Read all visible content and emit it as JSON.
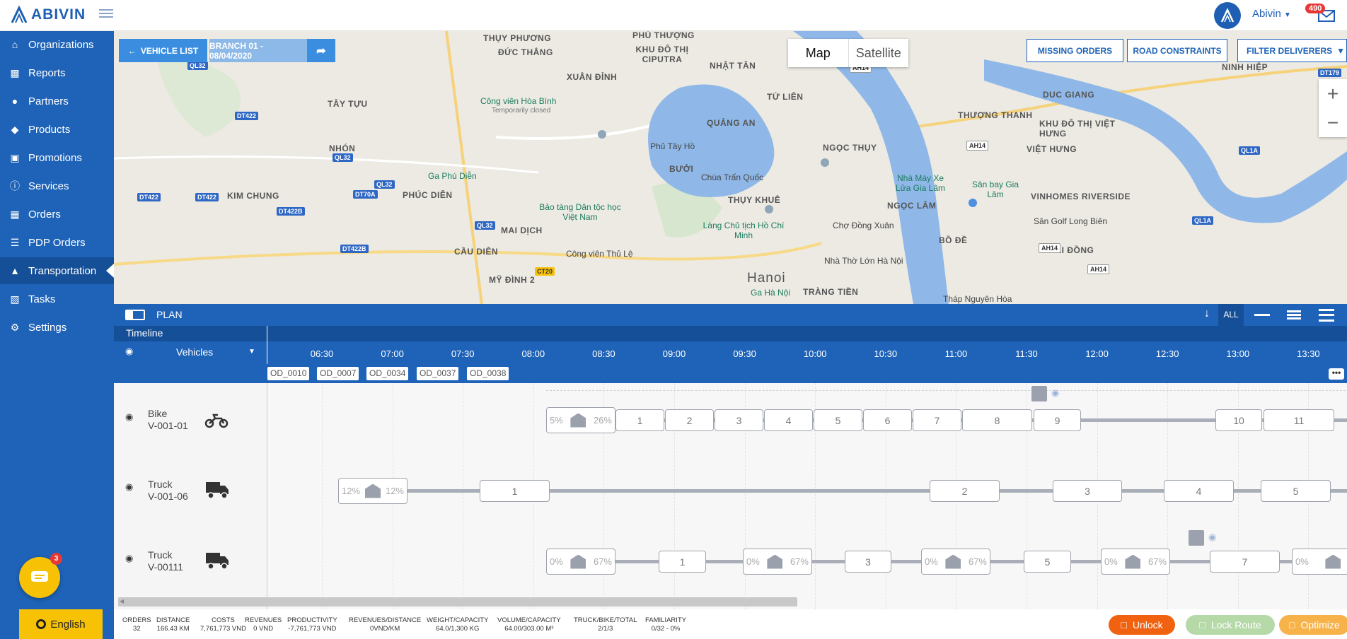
{
  "header": {
    "brand": "ABIVIN",
    "user_name": "Abivin",
    "notification_count": "490"
  },
  "sidebar": {
    "items": [
      {
        "label": "Organizations",
        "icon": "home-icon"
      },
      {
        "label": "Reports",
        "icon": "bar-chart-icon"
      },
      {
        "label": "Partners",
        "icon": "users-icon"
      },
      {
        "label": "Products",
        "icon": "dropbox-icon"
      },
      {
        "label": "Promotions",
        "icon": "gift-icon"
      },
      {
        "label": "Services",
        "icon": "info-icon"
      },
      {
        "label": "Orders",
        "icon": "cubes-icon"
      },
      {
        "label": "PDP Orders",
        "icon": "list-icon"
      },
      {
        "label": "Transportation",
        "icon": "road-icon"
      },
      {
        "label": "Tasks",
        "icon": "calendar-icon"
      },
      {
        "label": "Settings",
        "icon": "gear-icon"
      }
    ],
    "active": "Transportation",
    "chat_badge": "3",
    "language": "English"
  },
  "map": {
    "vehicle_list_label": "VEHICLE LIST",
    "branch_label": "BRANCH 01 - 08/04/2020",
    "map_label": "Map",
    "satellite_label": "Satellite",
    "missing_orders_label": "MISSING ORDERS",
    "road_constraints_label": "ROAD CONSTRAINTS",
    "filter_label": "FILTER DELIVERERS",
    "labels": [
      "THỤY PHƯƠNG",
      "ĐỨC THẮNG",
      "PHÚ THƯỢNG",
      "KHU ĐÔ THỊ CIPUTRA",
      "NHẬT TÂN",
      "XUÂN ĐỈNH",
      "TÂY TỰU",
      "Công viên Hòa Bình",
      "Temporarily closed",
      "QUẢNG AN",
      "TỨ LIÊN",
      "NHÓN",
      "Phủ Tây Hồ",
      "BƯỞI",
      "Chùa Trấn Quốc",
      "THỤY KHUÊ",
      "KIM CHUNG",
      "Ga Phú Diễn",
      "PHÚC DIỄN",
      "Bảo tàng Dân tộc học Việt Nam",
      "Làng Chủ tịch Hồ Chí Minh",
      "MAI DỊCH",
      "CẦU DIỄN",
      "MỸ ĐÌNH 2",
      "Công viên Thủ Lệ",
      "Hanoi",
      "Ga Hà Nội",
      "NGỌC THỤY",
      "Nhà Máy Xe Lửa Gia Lâm",
      "Chợ Đồng Xuân",
      "NGỌC LÂM",
      "Nhà Thờ Lớn Hà Nội",
      "BỒ ĐỀ",
      "TRÀNG TIỀN",
      "Tháp Nguyên Hòa",
      "THƯỢNG THANH",
      "Sân bay Gia Lâm",
      "DUC GIANG",
      "KHU ĐÔ THỊ VIỆT HƯNG",
      "VIỆT HƯNG",
      "VINHOMES RIVERSIDE",
      "Sân Golf Long Biên",
      "SÀI ĐỒNG",
      "NINH HIỆP"
    ],
    "road_tags": [
      "QL32",
      "DT422",
      "QL32",
      "DT422",
      "DT422",
      "DT70A",
      "QL32",
      "DT422B",
      "DT422B",
      "QL32",
      "CT20",
      "AH14",
      "AH14",
      "AH14",
      "AH14",
      "QL1A",
      "QL1A",
      "DT179"
    ]
  },
  "plan": {
    "title": "PLAN",
    "all_label": "ALL",
    "timeline_label": "Timeline",
    "vehicles_label": "Vehicles",
    "times": [
      "06:30",
      "07:00",
      "07:30",
      "08:00",
      "08:30",
      "09:00",
      "09:30",
      "10:00",
      "10:30",
      "11:00",
      "11:30",
      "12:00",
      "12:30",
      "13:00",
      "13:30"
    ],
    "orders": [
      "OD_0010",
      "OD_0007",
      "OD_0034",
      "OD_0037",
      "OD_0038"
    ],
    "vehicles": [
      {
        "type": "Bike",
        "id": "V-001-01",
        "icon": "motorcycle-icon"
      },
      {
        "type": "Truck",
        "id": "V-001-06",
        "icon": "truck-icon"
      },
      {
        "type": "Truck",
        "id": "V-00111",
        "icon": "truck-icon"
      }
    ],
    "routes": [
      {
        "depots": [
          {
            "left": "5%",
            "right": "26%"
          }
        ],
        "stops": [
          "1",
          "2",
          "3",
          "4",
          "5",
          "6",
          "7",
          "8",
          "9",
          "10",
          "11"
        ]
      },
      {
        "depots": [
          {
            "left": "12%",
            "right": "12%"
          }
        ],
        "stops": [
          "1",
          "2",
          "3",
          "4",
          "5"
        ]
      },
      {
        "depots": [
          {
            "left": "0%",
            "right": "67%"
          },
          {
            "left": "0%",
            "right": "67%"
          },
          {
            "left": "0%",
            "right": "67%"
          },
          {
            "left": "0%",
            "right": "67%"
          },
          {
            "left": "0%",
            "right": ""
          }
        ],
        "stops": [
          "1",
          "3",
          "5",
          "7"
        ]
      }
    ]
  },
  "stats": [
    {
      "label": "ORDERS",
      "value": "32"
    },
    {
      "label": "DISTANCE",
      "value": "166.43 KM"
    },
    {
      "label": "COSTS",
      "value": "7,761,773 VND"
    },
    {
      "label": "REVENUES",
      "value": "0 VND"
    },
    {
      "label": "PRODUCTIVITY",
      "value": "-7,761,773 VND"
    },
    {
      "label": "REVENUES/DISTANCE",
      "value": "0VND/KM"
    },
    {
      "label": "WEIGHT/CAPACITY",
      "value": "64.0/1,300 KG"
    },
    {
      "label": "VOLUME/CAPACITY",
      "value": "64.00/303.00 M³"
    },
    {
      "label": "TRUCK/BIKE/TOTAL",
      "value": "2/1/3"
    },
    {
      "label": "FAMILIARITY",
      "value": "0/32 - 0%"
    }
  ],
  "actions": {
    "unlock": "Unlock",
    "lock_route": "Lock Route",
    "optimize": "Optimize"
  },
  "colors": {
    "primary": "#1e63b8",
    "unlock": "#f0620f",
    "lock_route": "#b6d9a8",
    "optimize": "#f7b24a"
  }
}
